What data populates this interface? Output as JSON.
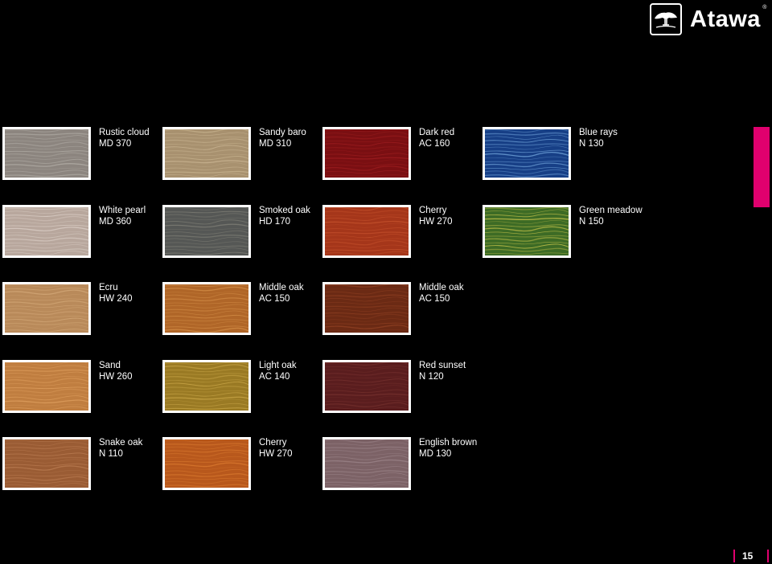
{
  "brand": {
    "name": "Atawa",
    "registered": "®",
    "accent_color": "#e0006e"
  },
  "swatches": [
    {
      "name": "Rustic cloud",
      "code": "MD 370",
      "base": "#8c857f",
      "grain": "#b0aba4",
      "row": 0,
      "col": 0
    },
    {
      "name": "Sandy baro",
      "code": "MD 310",
      "base": "#a8916f",
      "grain": "#c8b390",
      "row": 0,
      "col": 1
    },
    {
      "name": "Dark red",
      "code": "AC 160",
      "base": "#7a0f12",
      "grain": "#9e1e20",
      "row": 0,
      "col": 2
    },
    {
      "name": "Blue rays",
      "code": "N 130",
      "base": "#173f86",
      "grain": "#6d9fd6",
      "row": 0,
      "col": 3
    },
    {
      "name": "White pearl",
      "code": "MD 360",
      "base": "#b8a79d",
      "grain": "#d9cdc4",
      "row": 1,
      "col": 0
    },
    {
      "name": "Smoked oak",
      "code": "HD 170",
      "base": "#555755",
      "grain": "#7c7c74",
      "row": 1,
      "col": 1
    },
    {
      "name": "Cherry",
      "code": "HW 270",
      "base": "#a5361a",
      "grain": "#c3502b",
      "row": 1,
      "col": 2
    },
    {
      "name": "Green meadow",
      "code": "N 150",
      "base": "#3d6b25",
      "grain": "#c4c24a",
      "row": 1,
      "col": 3
    },
    {
      "name": "Ecru",
      "code": "HW 240",
      "base": "#b98a5a",
      "grain": "#d2a676",
      "row": 2,
      "col": 0
    },
    {
      "name": "Middle oak",
      "code": "AC 150",
      "base": "#b06628",
      "grain": "#d18b45",
      "row": 2,
      "col": 1
    },
    {
      "name": "Middle oak",
      "code": "AC 150",
      "base": "#6b2a14",
      "grain": "#8e3f22",
      "row": 2,
      "col": 2
    },
    {
      "name": "Sand",
      "code": "HW 260",
      "base": "#c07e40",
      "grain": "#dc9c5c",
      "row": 3,
      "col": 0
    },
    {
      "name": "Light oak",
      "code": "AC 140",
      "base": "#9a7a24",
      "grain": "#c7a446",
      "row": 3,
      "col": 1
    },
    {
      "name": "Red sunset",
      "code": "N 120",
      "base": "#5a1d1e",
      "grain": "#74302d",
      "row": 3,
      "col": 2
    },
    {
      "name": "Snake oak",
      "code": "N 110",
      "base": "#9a5c34",
      "grain": "#b87a50",
      "row": 4,
      "col": 0
    },
    {
      "name": "Cherry",
      "code": "HW 270",
      "base": "#b8581c",
      "grain": "#d8782e",
      "row": 4,
      "col": 1
    },
    {
      "name": "English brown",
      "code": "MD 130",
      "base": "#7c6266",
      "grain": "#9a8287",
      "row": 4,
      "col": 2
    }
  ],
  "page_number": "15",
  "colors": {
    "background": "#000000",
    "text": "#ffffff",
    "frame": "#ffffff"
  }
}
